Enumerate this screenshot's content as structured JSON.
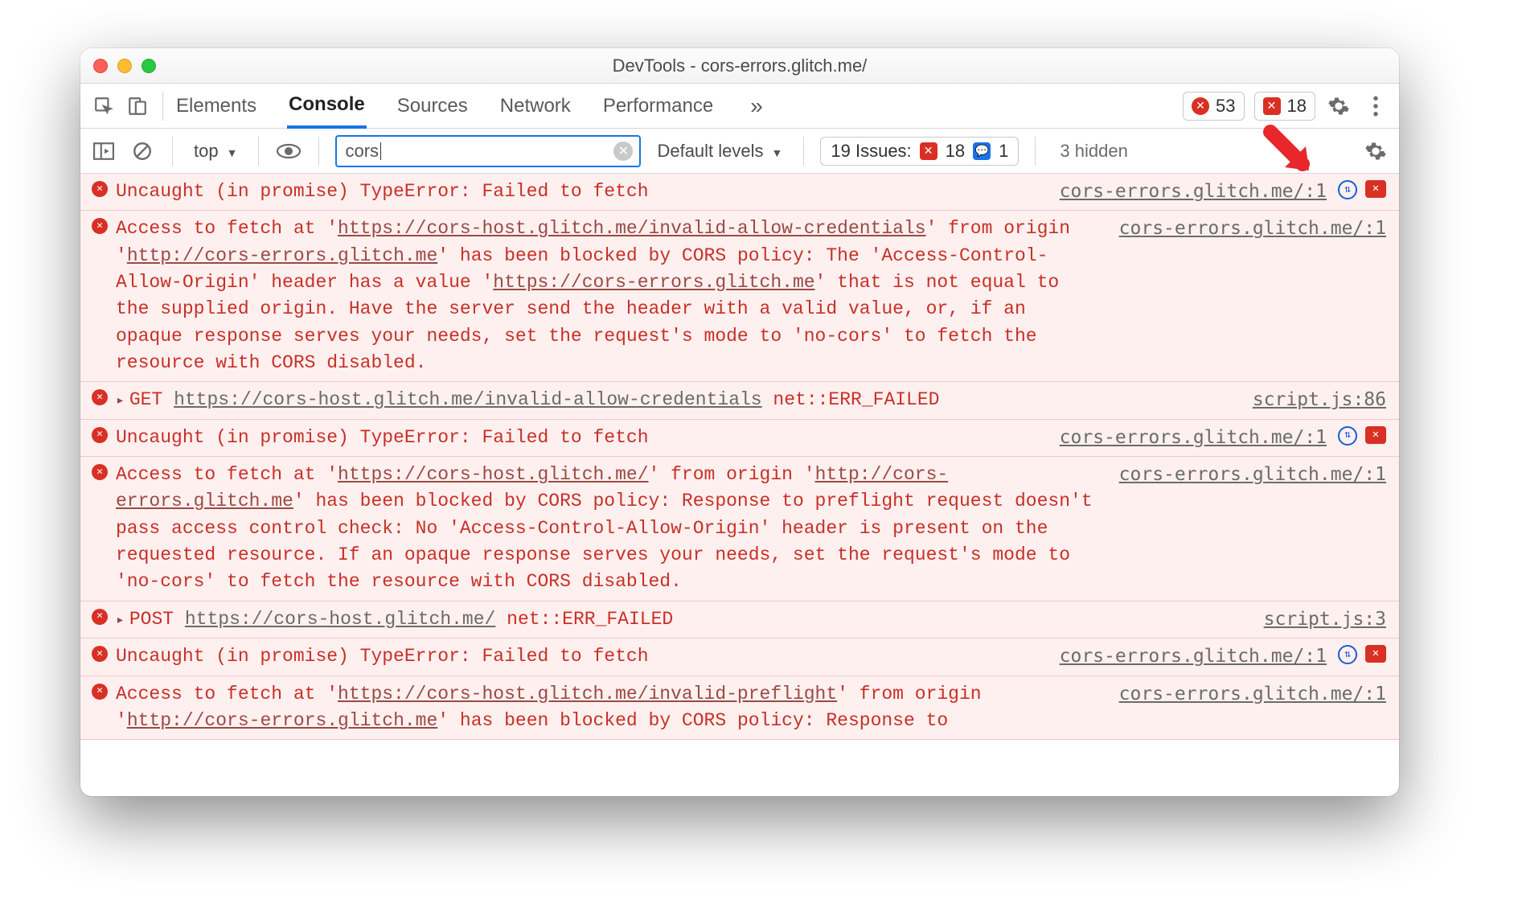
{
  "window": {
    "title": "DevTools - cors-errors.glitch.me/"
  },
  "tabs": {
    "items": [
      "Elements",
      "Console",
      "Sources",
      "Network",
      "Performance"
    ],
    "active": "Console",
    "more_glyph": "»"
  },
  "counters": {
    "errors": "53",
    "error_badges": "18"
  },
  "subbar": {
    "context": "top",
    "filter_value": "cors",
    "levels": "Default levels",
    "issues_label": "19 Issues:",
    "issues_errors": "18",
    "issues_info": "1",
    "hidden_text": "3 hidden"
  },
  "icons": {
    "clear_glyph": "✕",
    "error_glyph": "✕",
    "arrow_glyph": "↻",
    "comment_glyph": "✕",
    "info_glyph": "💬"
  },
  "messages": [
    {
      "type": "error",
      "text_parts": [
        "Uncaught (in promise) TypeError: Failed to fetch"
      ],
      "source": "cors-errors.glitch.me/:1",
      "tail_icons": true
    },
    {
      "type": "error",
      "source": "cors-errors.glitch.me/:1",
      "html": "Access to fetch at '<span class='linkish'>https://cors-host.glitch.me/invalid-allow-credentials</span>' from origin '<span class='linkish'>http://cors-errors.glitch.me</span>' has been blocked by CORS policy: The 'Access-Control-Allow-Origin' header has a value '<span class='linkish'>https://cors-errors.glitch.me</span>' that is not equal to the supplied origin. Have the server send the header with a valid value, or, if an opaque response serves your needs, set the request's mode to 'no-cors' to fetch the resource with CORS disabled."
    },
    {
      "type": "net",
      "method": "GET",
      "url": "https://cors-host.glitch.me/invalid-allow-credentials",
      "status": "net::ERR_FAILED",
      "source": "script.js:86"
    },
    {
      "type": "error",
      "text_parts": [
        "Uncaught (in promise) TypeError: Failed to fetch"
      ],
      "source": "cors-errors.glitch.me/:1",
      "tail_icons": true
    },
    {
      "type": "error",
      "source": "cors-errors.glitch.me/:1",
      "html": "Access to fetch at '<span class='linkish'>https://cors-host.glitch.me/</span>' from origin '<span class='linkish'>http://cors-errors.glitch.me</span>' has been blocked by CORS policy: Response to preflight request doesn't pass access control check: No 'Access-Control-Allow-Origin' header is present on the requested resource. If an opaque response serves your needs, set the request's mode to 'no-cors' to fetch the resource with CORS disabled."
    },
    {
      "type": "net",
      "method": "POST",
      "url": "https://cors-host.glitch.me/",
      "status": "net::ERR_FAILED",
      "source": "script.js:3"
    },
    {
      "type": "error",
      "text_parts": [
        "Uncaught (in promise) TypeError: Failed to fetch"
      ],
      "source": "cors-errors.glitch.me/:1",
      "tail_icons": true
    },
    {
      "type": "error",
      "source": "cors-errors.glitch.me/:1",
      "html": "Access to fetch at '<span class='linkish'>https://cors-host.glitch.me/invalid-preflight</span>' from origin '<span class='linkish'>http://cors-errors.glitch.me</span>' has been blocked by CORS policy: Response to"
    }
  ]
}
